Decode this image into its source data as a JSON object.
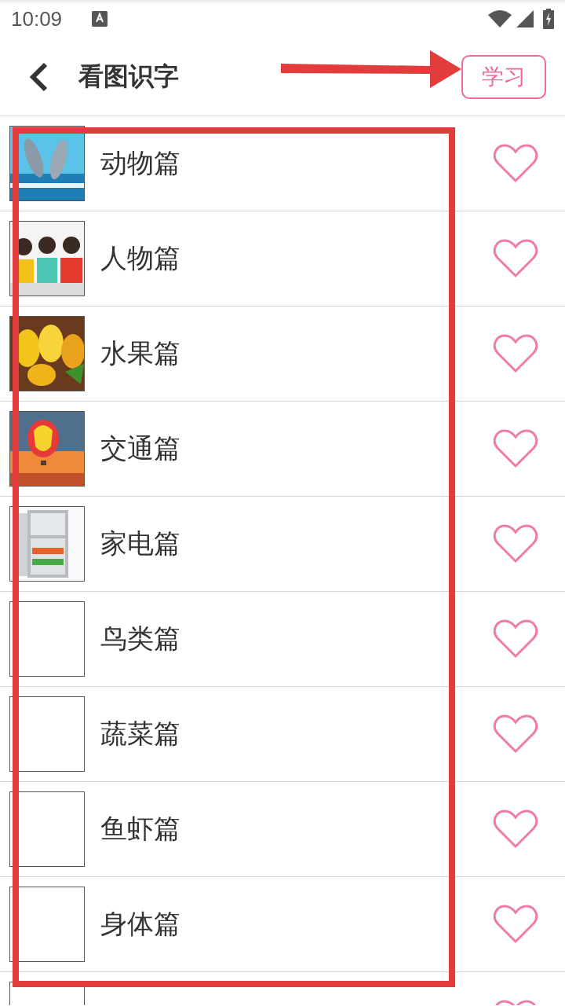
{
  "status_bar": {
    "time": "10:09"
  },
  "header": {
    "title": "看图识字",
    "action": "学习"
  },
  "items": [
    {
      "label": "动物篇",
      "kind": "picture",
      "favorite": false
    },
    {
      "label": "人物篇",
      "kind": "picture",
      "favorite": false
    },
    {
      "label": "水果篇",
      "kind": "picture",
      "favorite": false
    },
    {
      "label": "交通篇",
      "kind": "picture",
      "favorite": false
    },
    {
      "label": "家电篇",
      "kind": "picture",
      "favorite": false
    },
    {
      "label": "鸟类篇",
      "kind": "empty",
      "favorite": false
    },
    {
      "label": "蔬菜篇",
      "kind": "empty",
      "favorite": false
    },
    {
      "label": "鱼虾篇",
      "kind": "empty",
      "favorite": false
    },
    {
      "label": "身体篇",
      "kind": "empty",
      "favorite": false
    },
    {
      "kind": "empty",
      "favorite": false
    }
  ],
  "annotations": {
    "arrow": true,
    "highlight_frame": true
  }
}
